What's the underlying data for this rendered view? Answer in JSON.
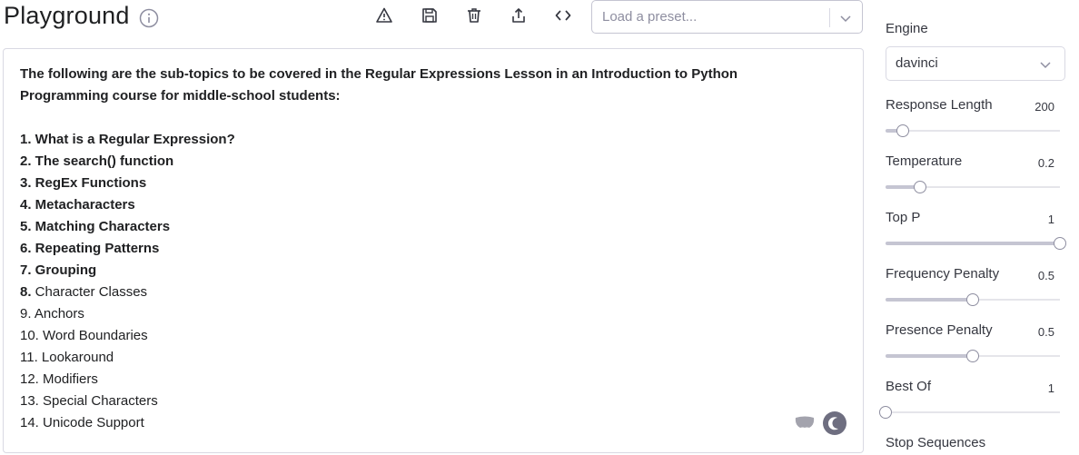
{
  "header": {
    "title": "Playground",
    "toolbar_icons": [
      "warning-icon",
      "save-icon",
      "trash-icon",
      "share-icon",
      "code-icon"
    ],
    "preset": {
      "placeholder": "Load a preset..."
    }
  },
  "editor": {
    "lines": [
      {
        "text": "The following are the sub-topics to be covered in the Regular Expressions Lesson in an Introduction to Python",
        "bold": true
      },
      {
        "text": "Programming course for middle-school students:",
        "bold": true
      },
      {
        "text": "",
        "bold": false
      },
      {
        "text": "1. What is a Regular Expression?",
        "bold": true
      },
      {
        "text": "2. The search() function",
        "bold": true
      },
      {
        "text": "3. RegEx Functions",
        "bold": true
      },
      {
        "text": "4. Metacharacters",
        "bold": true
      },
      {
        "text": "5. Matching Characters",
        "bold": true
      },
      {
        "text": "6. Repeating Patterns",
        "bold": true
      },
      {
        "text": "7. Grouping",
        "bold": true
      },
      {
        "text": "8.",
        "bold": true,
        "rest": " Character Classes"
      },
      {
        "text": "9. Anchors",
        "bold": false
      },
      {
        "text": "10. Word Boundaries",
        "bold": false
      },
      {
        "text": "11. Lookaround",
        "bold": false
      },
      {
        "text": "12. Modifiers",
        "bold": false
      },
      {
        "text": "13. Special Characters",
        "bold": false
      },
      {
        "text": "14. Unicode Support",
        "bold": false
      }
    ]
  },
  "sidebar": {
    "engine": {
      "label": "Engine",
      "value": "davinci"
    },
    "params": [
      {
        "label": "Response Length",
        "value": "200",
        "fraction": 0.1
      },
      {
        "label": "Temperature",
        "value": "0.2",
        "fraction": 0.2
      },
      {
        "label": "Top P",
        "value": "1",
        "fraction": 1.0
      },
      {
        "label": "Frequency Penalty",
        "value": "0.5",
        "fraction": 0.5
      },
      {
        "label": "Presence Penalty",
        "value": "0.5",
        "fraction": 0.5
      },
      {
        "label": "Best Of",
        "value": "1",
        "fraction": 0.0
      }
    ],
    "stop_sequences_label": "Stop Sequences"
  }
}
